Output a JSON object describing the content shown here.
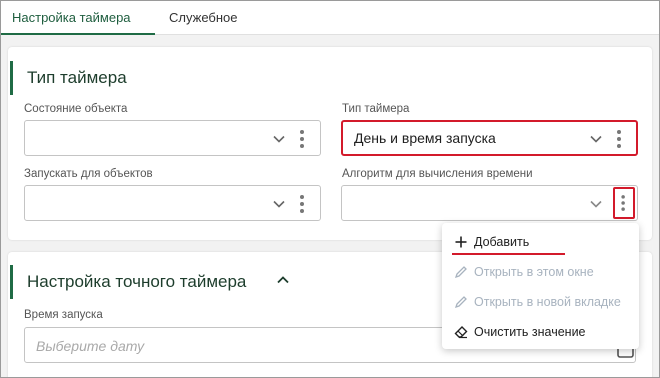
{
  "tabs": [
    {
      "label": "Настройка таймера",
      "active": true
    },
    {
      "label": "Служебное",
      "active": false
    }
  ],
  "timer_type_section": {
    "title": "Тип таймера",
    "fields": {
      "object_state": {
        "label": "Состояние объекта",
        "value": ""
      },
      "timer_type": {
        "label": "Тип таймера",
        "value": "День и время запуска"
      },
      "run_for_objects": {
        "label": "Запускать для объектов",
        "value": ""
      },
      "time_algorithm": {
        "label": "Алгоритм для вычисления времени",
        "value": ""
      }
    }
  },
  "exact_timer_section": {
    "title": "Настройка точного таймера",
    "start_time": {
      "label": "Время запуска",
      "placeholder": "Выберите дату"
    }
  },
  "context_menu": {
    "items": [
      {
        "label": "Добавить",
        "icon": "plus-icon",
        "enabled": true
      },
      {
        "label": "Открыть в этом окне",
        "icon": "pencil-icon",
        "enabled": false
      },
      {
        "label": "Открыть в новой вкладке",
        "icon": "pencil-icon",
        "enabled": false
      },
      {
        "label": "Очистить значение",
        "icon": "eraser-icon",
        "enabled": true
      }
    ]
  },
  "colors": {
    "accent_green": "#1f6b45",
    "highlight_red": "#d31a2b",
    "disabled_text": "#a8b3bf"
  }
}
